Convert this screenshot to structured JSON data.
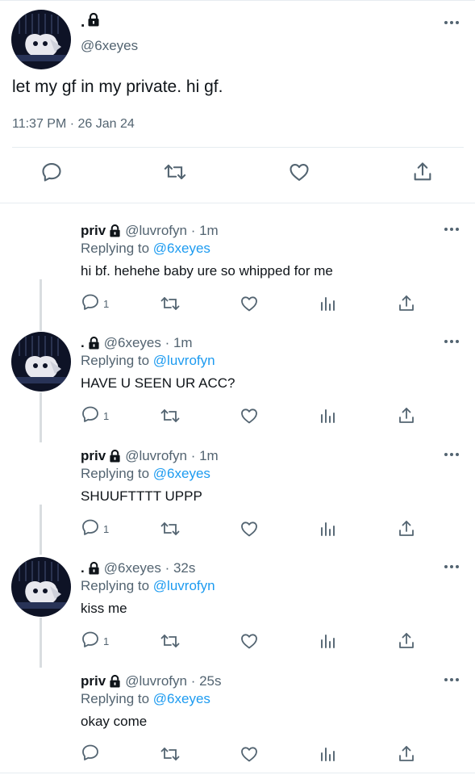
{
  "main": {
    "name": ".",
    "handle": "@6xeyes",
    "text": "let my gf in my private. hi gf.",
    "time": "11:37 PM · 26 Jan 24"
  },
  "replies": [
    {
      "name": "priv",
      "handle": "@luvrofyn",
      "time": "· 1m",
      "replying_prefix": "Replying to",
      "replying_to": "@6xeyes",
      "text": "hi bf. hehehe baby ure so whipped for me",
      "reply_count": "1"
    },
    {
      "name": ".",
      "handle": "@6xeyes",
      "time": "· 1m",
      "replying_prefix": "Replying to",
      "replying_to": "@luvrofyn",
      "text": "HAVE U SEEN UR ACC?",
      "reply_count": "1"
    },
    {
      "name": "priv",
      "handle": "@luvrofyn",
      "time": "· 1m",
      "replying_prefix": "Replying to",
      "replying_to": "@6xeyes",
      "text": "SHUUFTTTT UPPP",
      "reply_count": "1"
    },
    {
      "name": ".",
      "handle": "@6xeyes",
      "time": "· 32s",
      "replying_prefix": "Replying to",
      "replying_to": "@luvrofyn",
      "text": "kiss me",
      "reply_count": "1"
    },
    {
      "name": "priv",
      "handle": "@luvrofyn",
      "time": "· 25s",
      "replying_prefix": "Replying to",
      "replying_to": "@6xeyes",
      "text": "okay come",
      "reply_count": ""
    }
  ],
  "icons": {
    "reply": "reply-icon",
    "retweet": "retweet-icon",
    "like": "heart-icon",
    "views": "views-icon",
    "share": "share-icon",
    "more": "more-icon",
    "lock": "lock-icon"
  },
  "colors": {
    "text": "#0f1419",
    "secondary": "#536471",
    "link": "#1d9bf0",
    "divider": "#e6ecf0",
    "avatar_bg": "#0e1326"
  }
}
